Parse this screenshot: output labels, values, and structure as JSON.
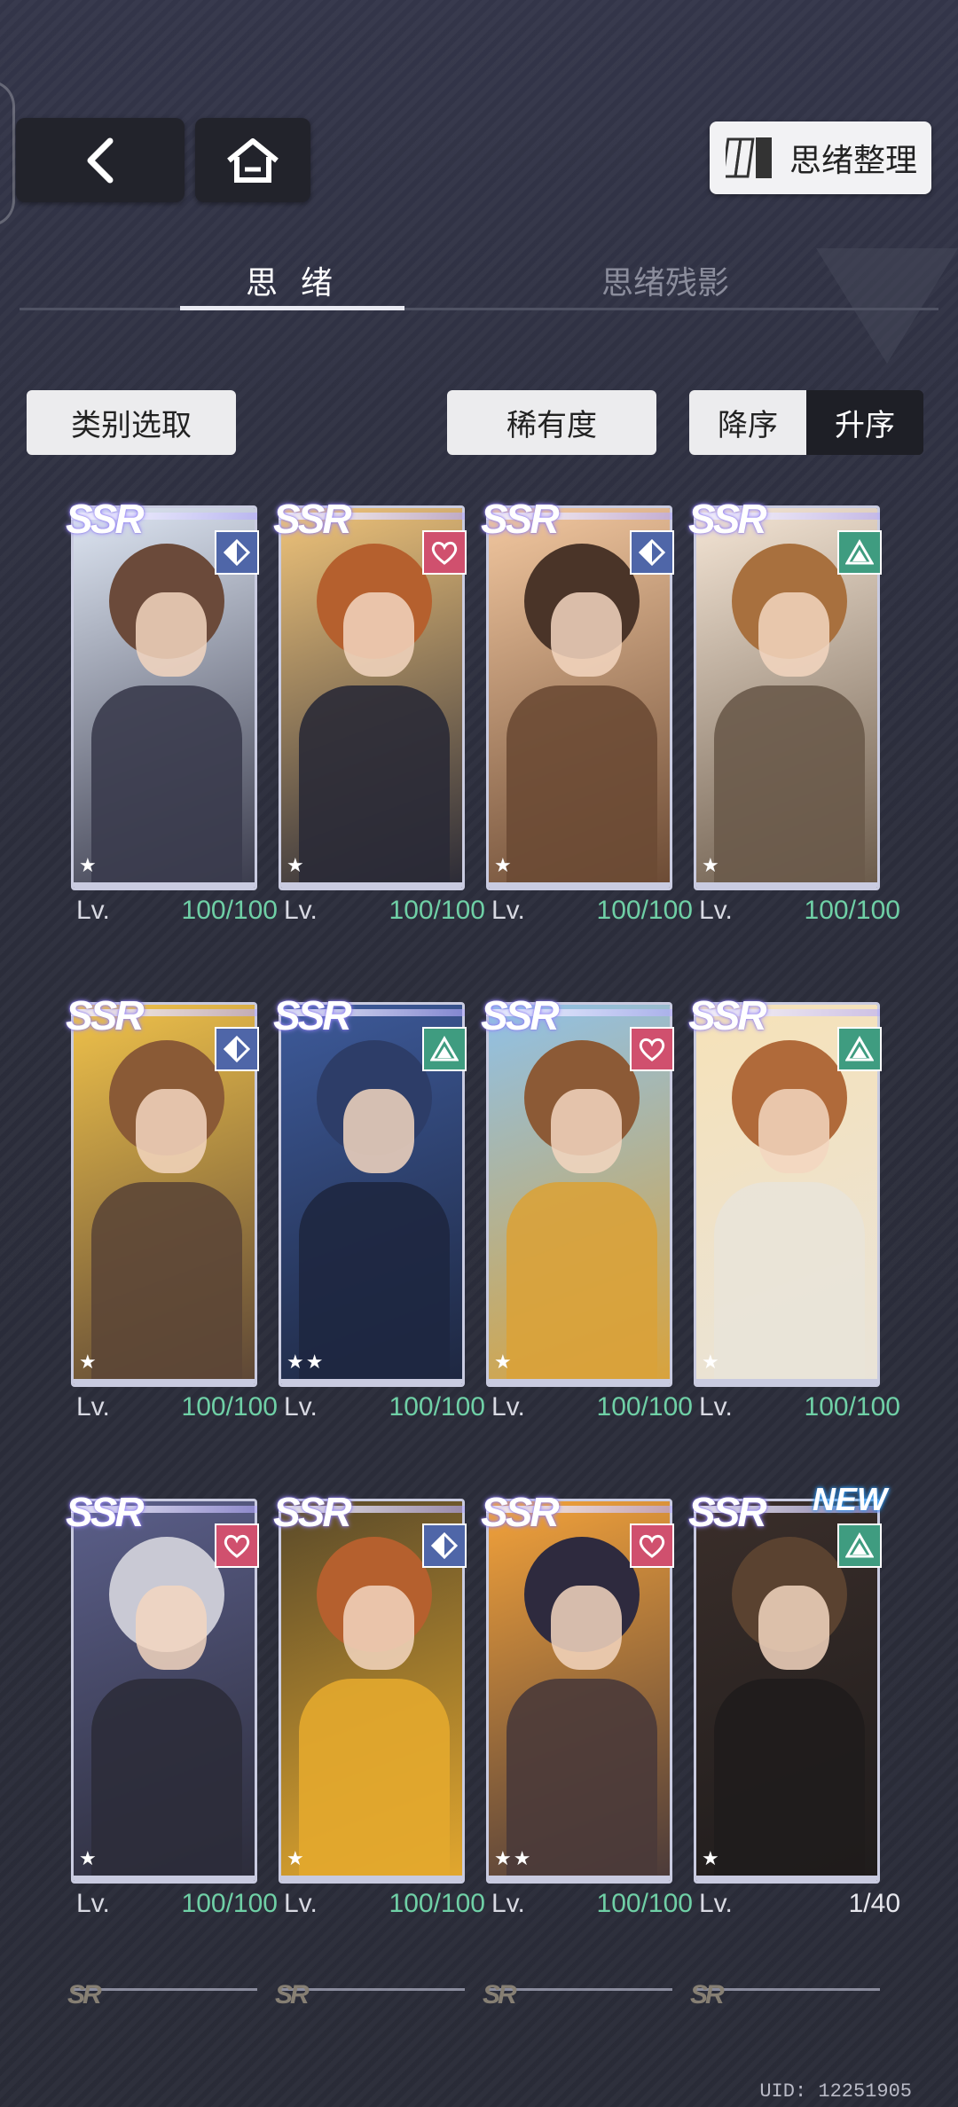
{
  "nav": {
    "back_icon": "chevron-left-icon",
    "home_icon": "home-icon",
    "organize_label": "思绪整理",
    "organize_icon": "cards-stack-icon"
  },
  "tabs": [
    {
      "label": "思 绪",
      "active": true
    },
    {
      "label": "思绪残影",
      "active": false
    }
  ],
  "filters": {
    "category_label": "类别选取",
    "rarity_label": "稀有度",
    "sort_desc_label": "降序",
    "sort_asc_label": "升序",
    "sort_selected": "降序"
  },
  "colors": {
    "badge_blue": "#4f66a8",
    "badge_pink": "#d0506e",
    "badge_green": "#3f9c80",
    "level_green": "#6fd0a6"
  },
  "cards": [
    {
      "rarity": "SSR",
      "type": "diamond-icon",
      "stars": "★",
      "lv_label": "Lv.",
      "level": "100/100",
      "is_new": false,
      "new_label": ""
    },
    {
      "rarity": "SSR",
      "type": "heart-icon",
      "stars": "★",
      "lv_label": "Lv.",
      "level": "100/100",
      "is_new": false,
      "new_label": ""
    },
    {
      "rarity": "SSR",
      "type": "diamond-icon",
      "stars": "★",
      "lv_label": "Lv.",
      "level": "100/100",
      "is_new": false,
      "new_label": ""
    },
    {
      "rarity": "SSR",
      "type": "triangle-icon",
      "stars": "★",
      "lv_label": "Lv.",
      "level": "100/100",
      "is_new": false,
      "new_label": ""
    },
    {
      "rarity": "SSR",
      "type": "diamond-icon",
      "stars": "★",
      "lv_label": "Lv.",
      "level": "100/100",
      "is_new": false,
      "new_label": ""
    },
    {
      "rarity": "SSR",
      "type": "triangle-icon",
      "stars": "★★",
      "lv_label": "Lv.",
      "level": "100/100",
      "is_new": false,
      "new_label": ""
    },
    {
      "rarity": "SSR",
      "type": "heart-icon",
      "stars": "★",
      "lv_label": "Lv.",
      "level": "100/100",
      "is_new": false,
      "new_label": ""
    },
    {
      "rarity": "SSR",
      "type": "triangle-icon",
      "stars": "★",
      "lv_label": "Lv.",
      "level": "100/100",
      "is_new": false,
      "new_label": ""
    },
    {
      "rarity": "SSR",
      "type": "heart-icon",
      "stars": "★",
      "lv_label": "Lv.",
      "level": "100/100",
      "is_new": false,
      "new_label": ""
    },
    {
      "rarity": "SSR",
      "type": "diamond-icon",
      "stars": "★",
      "lv_label": "Lv.",
      "level": "100/100",
      "is_new": false,
      "new_label": ""
    },
    {
      "rarity": "SSR",
      "type": "heart-icon",
      "stars": "★★",
      "lv_label": "Lv.",
      "level": "100/100",
      "is_new": false,
      "new_label": ""
    },
    {
      "rarity": "SSR",
      "type": "triangle-icon",
      "stars": "★",
      "lv_label": "Lv.",
      "level": "1/40",
      "is_new": true,
      "new_label": "NEW"
    }
  ],
  "uid": "UID: 12251905"
}
